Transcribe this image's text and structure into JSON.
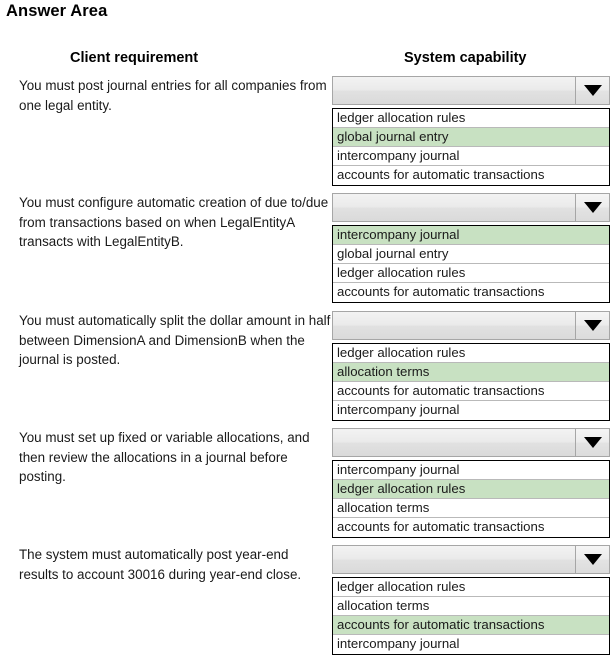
{
  "page": {
    "title": "Answer Area"
  },
  "headers": {
    "left": "Client requirement",
    "right": "System capability"
  },
  "colors": {
    "selected_highlight": "#c8e1c2",
    "combo_background": "#e8e8e8",
    "list_border": "#000000",
    "text": "#1a1a1a"
  },
  "icons": {
    "dropdown": "chevron-down-icon"
  },
  "combo": {
    "value": "",
    "placeholder": ""
  },
  "rows": [
    {
      "requirement": "You must post journal entries for all companies from one legal entity.",
      "selected_value": "",
      "options": [
        {
          "label": "ledger allocation rules",
          "selected": false
        },
        {
          "label": "global journal entry",
          "selected": true
        },
        {
          "label": "intercompany journal",
          "selected": false
        },
        {
          "label": "accounts for automatic transactions",
          "selected": false
        }
      ]
    },
    {
      "requirement": "You must configure automatic creation of due to/due from transactions based on when LegalEntityA transacts with LegalEntityB.",
      "selected_value": "",
      "options": [
        {
          "label": "intercompany journal",
          "selected": true
        },
        {
          "label": "global journal entry",
          "selected": false
        },
        {
          "label": "ledger allocation rules",
          "selected": false
        },
        {
          "label": "accounts for automatic transactions",
          "selected": false
        }
      ]
    },
    {
      "requirement": "You must automatically split the dollar amount in half between DimensionA and DimensionB when the journal is posted.",
      "selected_value": "",
      "options": [
        {
          "label": "ledger allocation rules",
          "selected": false
        },
        {
          "label": "allocation terms",
          "selected": true
        },
        {
          "label": "accounts for automatic transactions",
          "selected": false
        },
        {
          "label": "intercompany journal",
          "selected": false
        }
      ]
    },
    {
      "requirement": "You must set up fixed or variable allocations, and then review the allocations in a journal before posting.",
      "selected_value": "",
      "options": [
        {
          "label": "intercompany journal",
          "selected": false
        },
        {
          "label": "ledger allocation rules",
          "selected": true
        },
        {
          "label": "allocation terms",
          "selected": false
        },
        {
          "label": "accounts for automatic transactions",
          "selected": false
        }
      ]
    },
    {
      "requirement": "The system must automatically post year-end results to account 30016 during year-end close.",
      "selected_value": "",
      "options": [
        {
          "label": "ledger allocation rules",
          "selected": false
        },
        {
          "label": "allocation terms",
          "selected": false
        },
        {
          "label": "accounts for automatic transactions",
          "selected": true
        },
        {
          "label": "intercompany journal",
          "selected": false
        }
      ]
    }
  ]
}
